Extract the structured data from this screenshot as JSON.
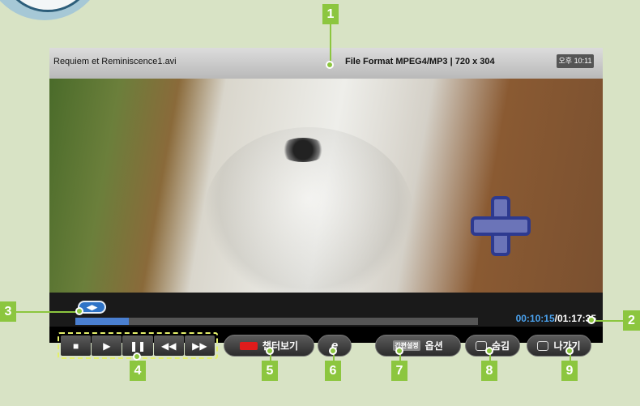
{
  "player": {
    "filename": "Requiem et Reminiscence1.avi",
    "file_format": "File Format MPEG4/MP3 | 720 x 304",
    "clock": "오후 10:11"
  },
  "progress": {
    "current_time": "00:10:15",
    "total_time": "/01:17:35",
    "handle_label": "◀▶",
    "fraction": 0.132
  },
  "controls": {
    "stop": "■",
    "play": "▶",
    "pause": "❚❚",
    "rewind": "◀◀",
    "forward": "▶▶"
  },
  "buttons": {
    "chapter": "챕터보기",
    "energy": "e",
    "quick_settings_tag": "간편설정",
    "options": "옵션",
    "hide": "숨김",
    "exit": "나가기"
  },
  "callouts": [
    "1",
    "2",
    "3",
    "4",
    "5",
    "6",
    "7",
    "8",
    "9"
  ],
  "colors": {
    "callout": "#8cc63f",
    "time_current": "#4aa2ef",
    "red_key": "#e01b1b"
  }
}
